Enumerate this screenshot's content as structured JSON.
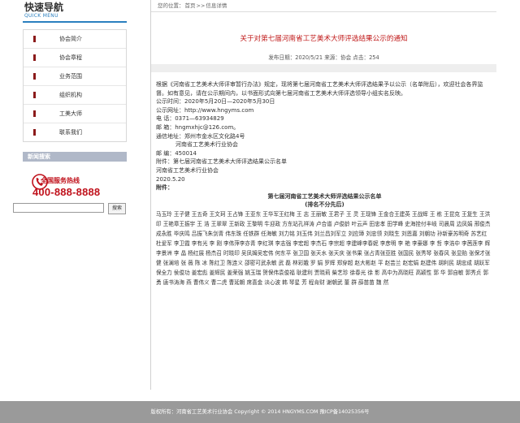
{
  "sidebar": {
    "title": "快速导航",
    "subtitle": "QUICK MENU",
    "items": [
      {
        "label": "协会简介"
      },
      {
        "label": "协会章程"
      },
      {
        "label": "业务范围"
      },
      {
        "label": "组织机构"
      },
      {
        "label": "工美大师"
      },
      {
        "label": "联系我们"
      }
    ],
    "news_search_label": "新闻搜索",
    "hotline_label": "全国服务热线",
    "hotline_number": "400-888-8888",
    "search_input_value": "",
    "search_button": "搜索"
  },
  "breadcrumb": {
    "prefix": "您的位置：",
    "home": "首页",
    "sep": ">>",
    "current": "信息详情"
  },
  "article": {
    "title": "关于对第七届河南省工艺美术大师评选结果公示的通知",
    "meta": "发布日期：2020/5/21     来源：协会     点击：254",
    "intro": "根据《河南省工艺美术大师评审暂行办法》规定，现将第七届河南省工艺美术大师评选结果予以公示（名单附后），欢迎社会各界监督。如有意见，请在公示期间内，以书面形式向第七届河南省工艺美术大师评选领导小组实名反映。",
    "period": "公示时间：2020年5月20日—2020年5月30日",
    "website": "公示网址：http://www.hngyms.com",
    "phone": "电    话：0371—63934829",
    "email": "邮    箱：hngmxhjc@126.com。",
    "address": "通信地址：郑州市金水区文化路4号",
    "address_org": "河南省工艺美术行业协会",
    "postcode": "邮    编：450014",
    "attachment": "附件：第七届河南省工艺美术大师评选结果公示名单",
    "sign_org": "河南省工艺美术行业协会",
    "sign_date": "2020.5.20",
    "annex_label": "附件：",
    "annex_title": "第七届河南省工艺美术大师评选结果公示名单",
    "annex_sub": "(排名不分先后)",
    "names": "马玉玲 王子健 王五奇 王文珂 王占锋 王亚东 王华军王红梅 王 志 王丽敏 王君子 王 灵 王现锋 王金合王建英 王战辉 王 栋 王昆克 王复生 王洪印 王艳章王振宇 王 浩 王翠翠 王新政 王黎明 牛迎政 方东站孔祥涛 卢合谱 卢俊龄 叶云声 田忠孝 田学峰 史海拴付丰岐 司晨周 边凤娟 邢俊杰 成永胜 毕庆鸣 吕振飞朱剑青 伟东珠 任铁群 任海敏 刘力铭 刘玉伟 刘兰昌刘军立 刘应璋 刘忠领 刘晓生 刘恩嘉 刘朝功 孙新豪苏明奇 苏艺红 杜爱军 李卫霞 李有光 李 刚 李伟萍李亦青 李红琪 李志强 李宏超 李杰石 李宗超 李建峰李春妮 李彦明 李 艳 李豪娜 李 哲 李浩中 李茜莲李 辉 李景洲 李 晶 杨红展 杨杰召 时晓印 吴凤姆吴宏伟 何东平 张卫国 张天水 张天庆 张书果 张占青张亚胜 张国民 张秀琴 张春风 张显贻 张保才张 健 张澜培 张 薇 陈 冰 陈红卫 陈连义 邵密可武永敏 武 磊 林彩娥 罗 娟 罗辉 郑穿超 赵大彬赵 平 赵芸兰 赵宏娟 赵建伟 胡利民 胡忠成 胡跃军保全力 侯俊功 姜宏彪 姜辉民 姜荣强 姚玉瑞 贺保伟袁俊福 耿建利 贾晓莉 柴艺珍 徐春光 徐 影 高中为高晓旺 高颖性 郭 华 郭自敏 郭秀贞 郭 勇 唐书涛海 燕 曹伟义 曹二虎 曹延朝 席喜金 淡心波 韩 琴星 芳 程肯财 谢朝武 董 群 薛苗苗 魏 然"
  },
  "footer": {
    "text": "版权所有：河南省工艺美术行业协会 Copyright © 2014 HNGYMS.COM 豫ICP备14025356号"
  },
  "colors": {
    "accent_blue": "#2a7fbf",
    "title_red": "#c01a1a",
    "menu_mark": "#8b1a1a",
    "footer_gray": "#9a9a9a"
  }
}
